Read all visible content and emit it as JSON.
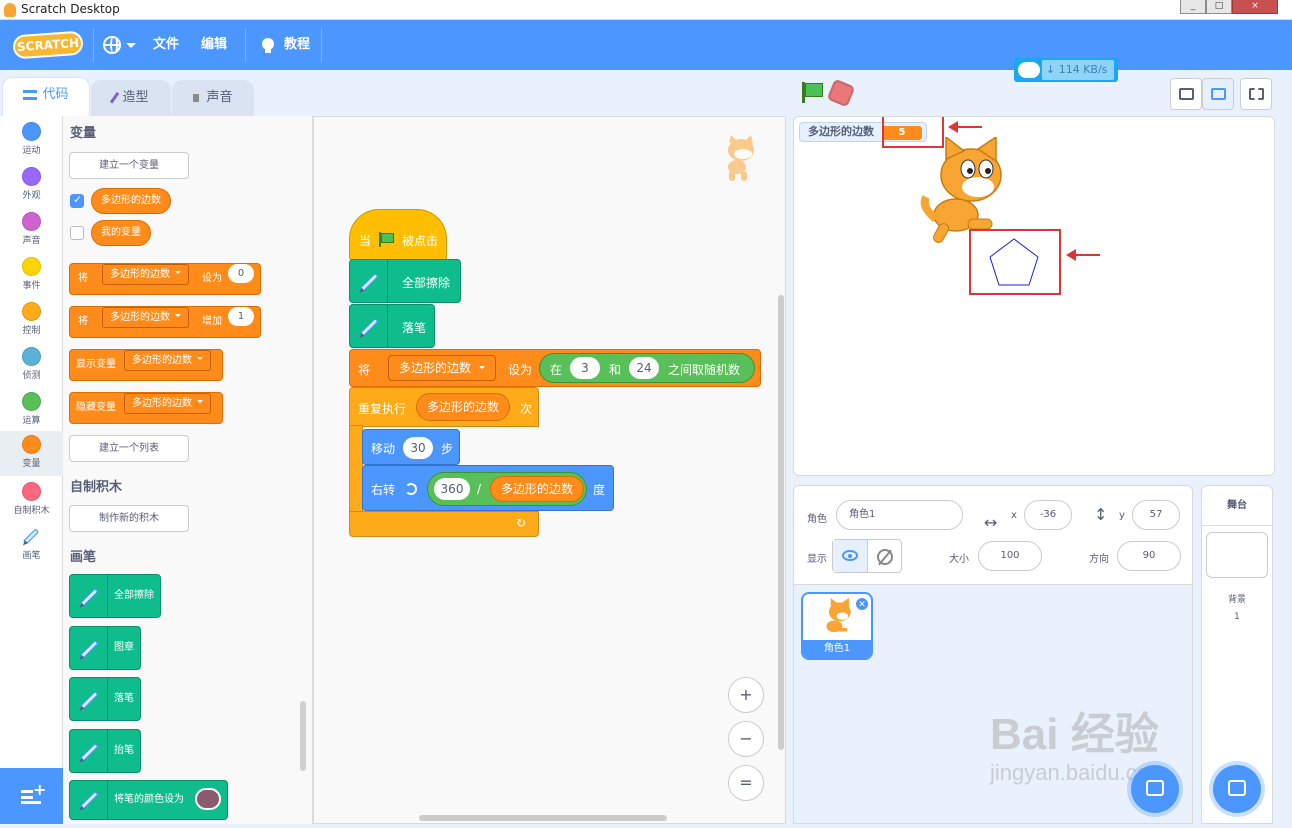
{
  "window": {
    "title": "Scratch Desktop",
    "btn_min": "_",
    "btn_max": "□",
    "btn_close": "×"
  },
  "menu": {
    "logo": "SCRATCH",
    "file": "文件",
    "edit": "编辑",
    "tutorials": "教程"
  },
  "tabs": {
    "code": "代码",
    "costumes": "造型",
    "sounds": "声音"
  },
  "categories": [
    {
      "label": "运动",
      "color": "#4c97ff"
    },
    {
      "label": "外观",
      "color": "#9966ff"
    },
    {
      "label": "声音",
      "color": "#cf63cf"
    },
    {
      "label": "事件",
      "color": "#ffd500"
    },
    {
      "label": "控制",
      "color": "#ffab19"
    },
    {
      "label": "侦测",
      "color": "#5cb1d6"
    },
    {
      "label": "运算",
      "color": "#59c059"
    },
    {
      "label": "变量",
      "color": "#ff8c1a"
    },
    {
      "label": "自制积木",
      "color": "#ff6680"
    },
    {
      "label": "画笔",
      "color": "#0fbd8c"
    }
  ],
  "palette": {
    "variables_heading": "变量",
    "make_variable": "建立一个变量",
    "var1": "多边形的边数",
    "var2": "我的变量",
    "set_block": {
      "prefix": "将",
      "var": "多边形的边数",
      "mid": "设为",
      "value": "0"
    },
    "change_block": {
      "prefix": "将",
      "var": "多边形的边数",
      "mid": "增加",
      "value": "1"
    },
    "show_block": {
      "prefix": "显示变量",
      "var": "多边形的边数"
    },
    "hide_block": {
      "prefix": "隐藏变量",
      "var": "多边形的边数"
    },
    "make_list": "建立一个列表",
    "myblocks_heading": "自制积木",
    "make_block": "制作新的积木",
    "pen_heading": "画笔",
    "pen_clear": "全部擦除",
    "pen_stamp": "图章",
    "pen_down": "落笔",
    "pen_up": "抬笔",
    "pen_color": "将笔的颜色设为"
  },
  "script": {
    "when_prefix": "当",
    "when_suffix": "被点击",
    "clear": "全部擦除",
    "pen_down": "落笔",
    "set_prefix": "将",
    "set_var": "多边形的边数",
    "set_mid": "设为",
    "random_prefix": "在",
    "random_from": "3",
    "random_and": "和",
    "random_to": "24",
    "random_suffix": "之间取随机数",
    "repeat_prefix": "重复执行",
    "repeat_var": "多边形的边数",
    "repeat_suffix": "次",
    "move_prefix": "移动",
    "move_steps": "30",
    "move_suffix": "步",
    "turn_prefix": "右转",
    "turn_dividend": "360",
    "turn_op": "/",
    "turn_divisor": "多边形的边数",
    "turn_suffix": "度",
    "loop_arrow": "↻"
  },
  "zoom": {
    "in": "+",
    "out": "−",
    "reset": "="
  },
  "network": {
    "speed": "114 KB/s"
  },
  "stage": {
    "monitor_label": "多边形的边数",
    "monitor_value": "5"
  },
  "sprite_info": {
    "sprite_label": "角色",
    "sprite_name": "角色1",
    "x_label": "x",
    "x_value": "-36",
    "y_label": "y",
    "y_value": "57",
    "show_label": "显示",
    "size_label": "大小",
    "size_value": "100",
    "direction_label": "方向",
    "direction_value": "90"
  },
  "sprites": [
    {
      "name": "角色1"
    }
  ],
  "stage_pane": {
    "header": "舞台",
    "backdrops_label": "背景",
    "backdrops_count": "1"
  },
  "watermark": {
    "brand": "Bai 经验",
    "url": "jingyan.baidu.com"
  }
}
